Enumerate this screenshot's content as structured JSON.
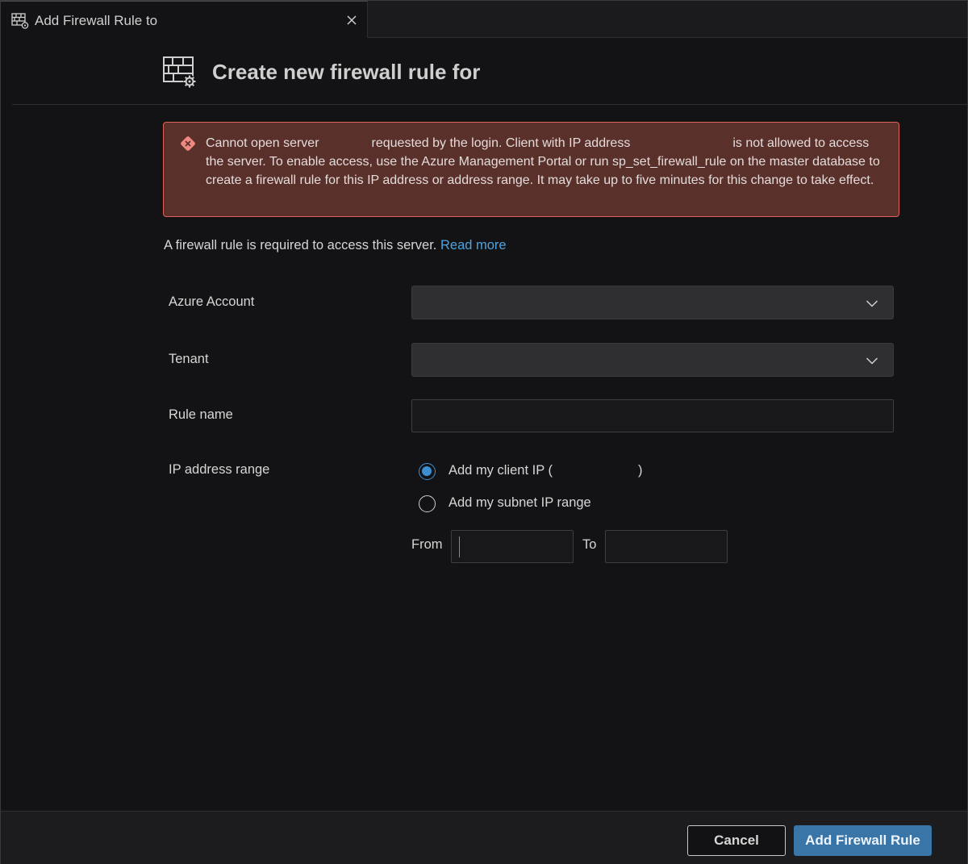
{
  "tab": {
    "title": "Add Firewall Rule to",
    "icon": "firewall-icon",
    "close_icon": "close-icon"
  },
  "header": {
    "title": "Create new firewall rule for",
    "icon": "firewall-settings-icon"
  },
  "error": {
    "icon": "error-icon",
    "text_part1": "Cannot open server",
    "text_part2": "requested by the login. Client with IP address",
    "text_part3": "is not allowed to access the server. To enable access, use the Azure Management Portal or run sp_set_firewall_rule on the master database to create a firewall rule for this IP address or address range. It may take up to five minutes for this change to take effect.",
    "border_color": "#e0605a",
    "background_color": "#5a302a"
  },
  "info": {
    "text": "A firewall rule is required to access this server.",
    "link": "Read more",
    "link_color": "#4da3e0"
  },
  "form": {
    "azure_account_label": "Azure Account",
    "azure_account_value": "",
    "tenant_label": "Tenant",
    "tenant_value": "",
    "rule_name_label": "Rule name",
    "rule_name_value": "",
    "ip_range_label": "IP address range",
    "option_client_ip_prefix": "Add my client IP (",
    "option_client_ip_suffix": ")",
    "option_client_ip_selected": true,
    "option_subnet": "Add my subnet IP range",
    "option_subnet_selected": false,
    "from_label": "From",
    "from_value": "",
    "to_label": "To",
    "to_value": ""
  },
  "footer": {
    "cancel_label": "Cancel",
    "add_label": "Add Firewall Rule",
    "primary_color": "#3a75a8"
  }
}
